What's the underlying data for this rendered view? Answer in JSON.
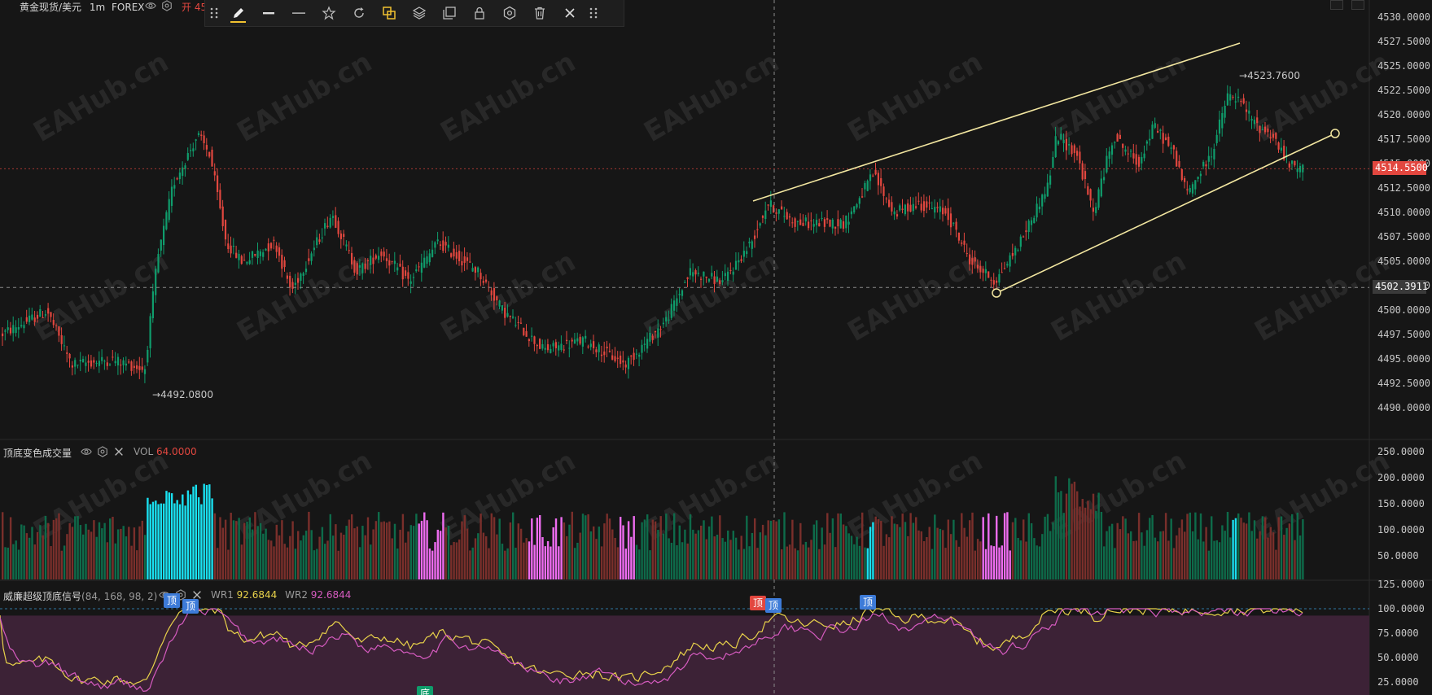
{
  "header": {
    "symbol": "黄金现货/美元",
    "interval": "1m",
    "market": "FOREX",
    "open_label": "开",
    "open_value_partial": "45"
  },
  "toolbar": {
    "tools": [
      {
        "icon": "grip-icon"
      },
      {
        "icon": "pencil-icon",
        "active": true
      },
      {
        "icon": "line-thick-icon"
      },
      {
        "icon": "line-thin-icon"
      },
      {
        "icon": "star-icon"
      },
      {
        "icon": "refresh-icon"
      },
      {
        "icon": "copy-color-icon"
      },
      {
        "icon": "layers-icon"
      },
      {
        "icon": "clone-icon"
      },
      {
        "icon": "lock-icon"
      },
      {
        "icon": "settings-icon"
      },
      {
        "icon": "trash-icon"
      },
      {
        "icon": "close-icon"
      },
      {
        "icon": "grip-icon"
      }
    ]
  },
  "price_axis": {
    "ticks": [
      "4530.0000",
      "4527.5000",
      "4525.0000",
      "4522.5000",
      "4520.0000",
      "4517.5000",
      "4515.0000",
      "4512.5000",
      "4510.0000",
      "4507.5000",
      "4505.0000",
      "4502.5000",
      "4500.0000",
      "4497.5000",
      "4495.0000",
      "4492.5000",
      "4490.0000"
    ],
    "current_price": "4514.5500",
    "crosshair_price": "4502.3911"
  },
  "annotations": {
    "high_label": "4523.7600",
    "low_label": "4492.0800"
  },
  "volume_panel": {
    "title": "顶底变色成交量",
    "vol_label": "VOL",
    "vol_value": "64.0000",
    "ticks": [
      "250.0000",
      "200.0000",
      "150.0000",
      "100.0000",
      "50.0000"
    ]
  },
  "signal_panel": {
    "title": "威廉超级顶底信号",
    "params": "(84, 168, 98, 2)",
    "wr1_label": "WR1",
    "wr1_value": "92.6844",
    "wr2_label": "WR2",
    "wr2_value": "92.6844",
    "ticks": [
      "125.0000",
      "100.0000",
      "75.0000",
      "50.0000",
      "25.0000"
    ],
    "top_badge": "顶",
    "bottom_badge": "底"
  },
  "watermark": "EAHub.cn",
  "colors": {
    "up": "#0f9d6c",
    "down": "#e2473f",
    "draw_line": "#f2e6a0",
    "wr1": "#e8d24a",
    "wr2": "#d65bc0",
    "cyan_vol": "#19e0f0",
    "magenta_vol": "#ee6cf0",
    "current_price_bg": "#e2473f",
    "crosshair_bg": "#3a3a3a"
  }
}
